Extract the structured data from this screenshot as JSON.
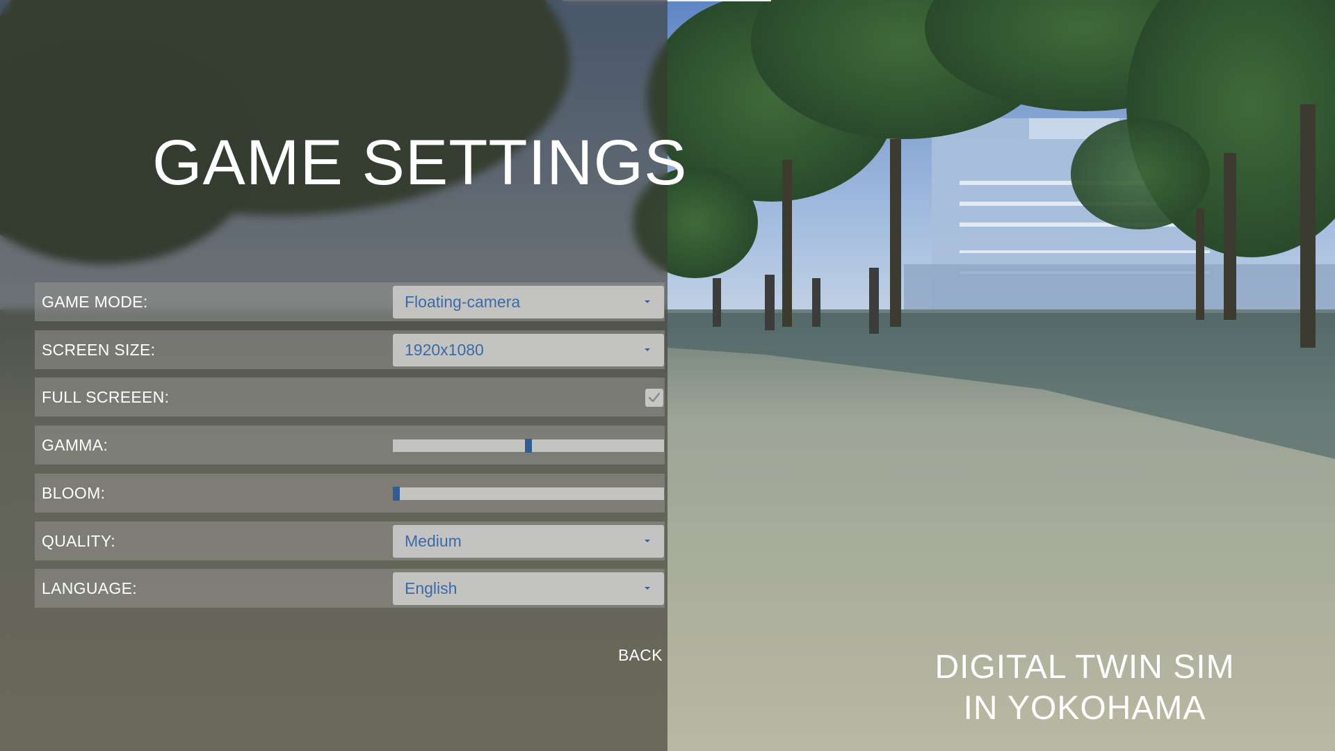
{
  "panel": {
    "title": "GAME SETTINGS",
    "back_label": "BACK"
  },
  "settings": {
    "game_mode": {
      "label": "GAME MODE:",
      "value": "Floating-camera"
    },
    "screen_size": {
      "label": "SCREEN SIZE:",
      "value": "1920x1080"
    },
    "full_screen": {
      "label": "FULL SCREEEN:",
      "checked": true
    },
    "gamma": {
      "label": "GAMMA:",
      "value": 0.5
    },
    "bloom": {
      "label": "BLOOM:",
      "value": 0.0
    },
    "quality": {
      "label": "QUALITY:",
      "value": "Medium"
    },
    "language": {
      "label": "LANGUAGE:",
      "value": "English"
    }
  },
  "tagline": {
    "line1": "DIGITAL TWIN SIM",
    "line2": "IN YOKOHAMA"
  },
  "icons": {
    "dropdown_caret": "chevron-down-icon",
    "checkbox_mark": "checkmark-icon"
  },
  "colors": {
    "accent": "#2f5c93",
    "dropdown_text": "#3c6aa6",
    "panel_overlay": "#3a3830",
    "control_bg": "#c3c3c1"
  }
}
